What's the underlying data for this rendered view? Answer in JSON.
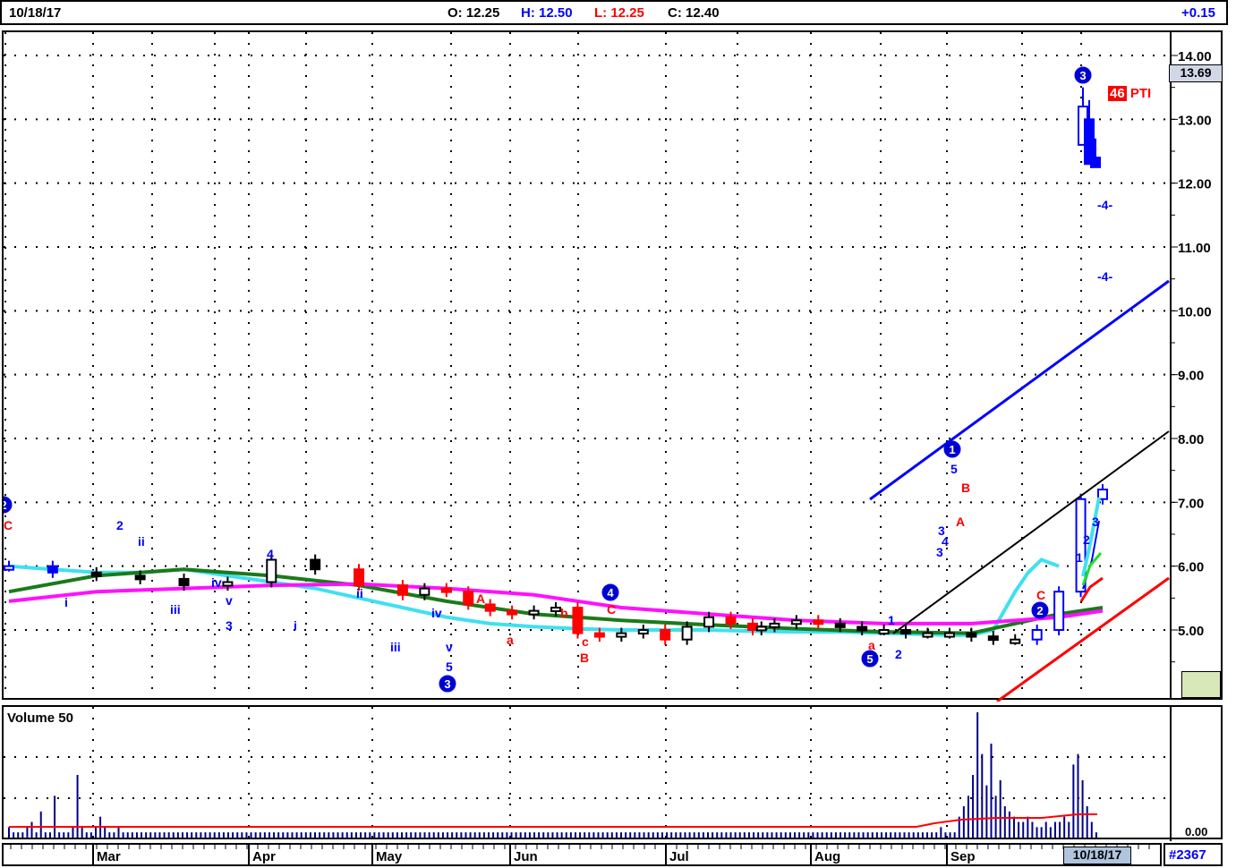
{
  "header": {
    "date": "10/18/17",
    "open": "O: 12.25",
    "high": "H: 12.50",
    "low": "L: 12.25",
    "close": "C: 12.40",
    "change": "+0.15"
  },
  "price_label": "13.69",
  "symbol_badge": {
    "count": "46",
    "ticker": "PTI"
  },
  "volume_title": "Volume 50",
  "volume_axis_label": "0.00",
  "date_highlight": "10/18/17",
  "chart_id": "#2367",
  "colors": {
    "up": "#0000ff",
    "down_red": "#ff0000",
    "neutral": "#000000",
    "ma_fast": "#40e0f0",
    "ma_mid": "#1a7a1a",
    "ma_slow": "#ff10ff",
    "volume": "#00008b",
    "volume_ma": "#ff0000"
  },
  "chart_data": {
    "type": "line",
    "x_tick_labels": [
      "Mar",
      "Apr",
      "May",
      "Jun",
      "Jul",
      "Aug",
      "Sep"
    ],
    "y_tick_labels": [
      "14.00",
      "13.00",
      "12.00",
      "11.00",
      "10.00",
      "9.00",
      "8.00",
      "7.00",
      "6.00",
      "5.00"
    ],
    "ylim": [
      4.0,
      14.4
    ],
    "grid": true,
    "price_series": {
      "name": "",
      "x": [
        0,
        10,
        20,
        30,
        40,
        50,
        60,
        70,
        80,
        90,
        95,
        100,
        105,
        110,
        115,
        120,
        125,
        130,
        135,
        140,
        145,
        150,
        155,
        160,
        165,
        170,
        172,
        175,
        180,
        185,
        190,
        195,
        200,
        205,
        210,
        215,
        220,
        225,
        230,
        235,
        240,
        245,
        250
      ],
      "y": [
        6.0,
        5.9,
        5.85,
        5.8,
        5.7,
        5.75,
        6.1,
        5.95,
        5.7,
        5.55,
        5.65,
        5.6,
        5.4,
        5.3,
        5.25,
        5.3,
        5.35,
        4.95,
        4.9,
        4.95,
        5.0,
        4.85,
        5.05,
        5.2,
        5.1,
        5.0,
        5.05,
        5.1,
        5.15,
        5.1,
        5.05,
        5.0,
        5.0,
        4.95,
        4.95,
        4.95,
        4.9,
        4.85,
        4.85,
        5.0,
        5.6,
        7.05,
        7.2
      ]
    },
    "series": [
      {
        "name": "",
        "color": "#40e0f0",
        "x": [
          0,
          10,
          20,
          30,
          40,
          50,
          60,
          70,
          80,
          90,
          100,
          110,
          120,
          130,
          140,
          150,
          160,
          170,
          180,
          190,
          200,
          210,
          215,
          220,
          225,
          230,
          233,
          236,
          240
        ],
        "y": [
          6.0,
          5.95,
          5.9,
          5.9,
          5.95,
          5.85,
          5.75,
          5.65,
          5.5,
          5.35,
          5.2,
          5.1,
          5.05,
          5.02,
          5.0,
          5.0,
          5.0,
          4.98,
          4.97,
          4.97,
          4.95,
          4.93,
          4.92,
          4.92,
          5.0,
          5.6,
          5.9,
          6.1,
          6.0
        ]
      },
      {
        "name": "",
        "color": "#1a7a1a",
        "x": [
          0,
          20,
          40,
          60,
          80,
          100,
          120,
          140,
          160,
          180,
          200,
          220,
          230,
          240,
          250
        ],
        "y": [
          5.6,
          5.85,
          5.95,
          5.85,
          5.7,
          5.45,
          5.25,
          5.15,
          5.08,
          5.02,
          4.97,
          4.95,
          5.1,
          5.25,
          5.35
        ]
      },
      {
        "name": "",
        "color": "#ff10ff",
        "x": [
          0,
          20,
          40,
          60,
          80,
          100,
          120,
          140,
          160,
          180,
          200,
          220,
          240,
          250
        ],
        "y": [
          5.45,
          5.6,
          5.65,
          5.7,
          5.72,
          5.65,
          5.55,
          5.35,
          5.25,
          5.15,
          5.1,
          5.1,
          5.2,
          5.3
        ]
      }
    ],
    "volume": {
      "ylabel": "Volume 50",
      "bars": [
        2,
        1,
        1,
        1,
        2,
        3,
        1,
        5,
        1,
        1,
        8,
        1,
        1,
        1,
        2,
        12,
        2,
        1,
        1,
        2,
        4,
        2,
        1,
        1,
        2,
        1,
        1,
        1,
        1,
        1,
        1,
        1,
        1,
        1,
        1,
        1,
        1,
        1,
        1,
        1,
        1,
        1,
        1,
        1,
        1,
        1,
        1,
        1,
        1,
        1,
        1,
        1,
        1,
        1,
        1,
        1,
        1,
        1,
        1,
        1,
        1,
        1,
        1,
        1,
        1,
        1,
        1,
        1,
        1,
        1,
        1,
        1,
        1,
        1,
        1,
        1,
        1,
        1,
        1,
        1,
        1,
        1,
        1,
        1,
        1,
        1,
        1,
        1,
        1,
        1,
        1,
        1,
        1,
        1,
        1,
        1,
        1,
        1,
        1,
        1,
        1,
        1,
        1,
        1,
        1,
        1,
        1,
        1,
        1,
        1,
        1,
        1,
        1,
        1,
        1,
        1,
        1,
        1,
        1,
        1,
        1,
        1,
        1,
        1,
        1,
        1,
        1,
        1,
        1,
        1,
        1,
        1,
        1,
        1,
        1,
        1,
        1,
        1,
        1,
        1,
        1,
        1,
        1,
        1,
        1,
        1,
        1,
        1,
        1,
        1,
        1,
        1,
        1,
        1,
        1,
        1,
        1,
        1,
        1,
        1,
        1,
        1,
        1,
        1,
        1,
        1,
        1,
        1,
        1,
        1,
        1,
        1,
        1,
        1,
        1,
        1,
        1,
        1,
        1,
        1,
        1,
        1,
        1,
        1,
        1,
        1,
        1,
        1,
        1,
        1,
        1,
        1,
        1,
        1,
        1,
        1,
        1,
        1,
        1,
        1,
        1,
        1,
        1,
        1,
        2,
        1,
        1,
        1,
        4,
        6,
        8,
        12,
        24,
        16,
        10,
        18,
        8,
        11,
        6,
        5,
        4,
        3,
        3,
        4,
        3,
        2,
        2,
        3,
        2,
        3,
        3,
        4,
        3,
        14,
        16,
        11,
        6,
        3,
        1
      ]
    },
    "wave_labels_blue": [
      "2",
      "ii",
      "i",
      "iii",
      "iv",
      "v",
      "3",
      "4",
      "i",
      "ii",
      "iii",
      "iv",
      "v",
      "5",
      "3",
      "1",
      "2",
      "3",
      "4",
      "5",
      "1",
      "2",
      "3"
    ],
    "wave_labels_red": [
      "C",
      "A",
      "a",
      "b",
      "c",
      "B",
      "C",
      "A",
      "B",
      "C",
      "a"
    ],
    "wave_circles": [
      "2",
      "3",
      "4",
      "5",
      "1",
      "2",
      "3"
    ],
    "target_labels": [
      "-4-",
      "-4-"
    ]
  }
}
